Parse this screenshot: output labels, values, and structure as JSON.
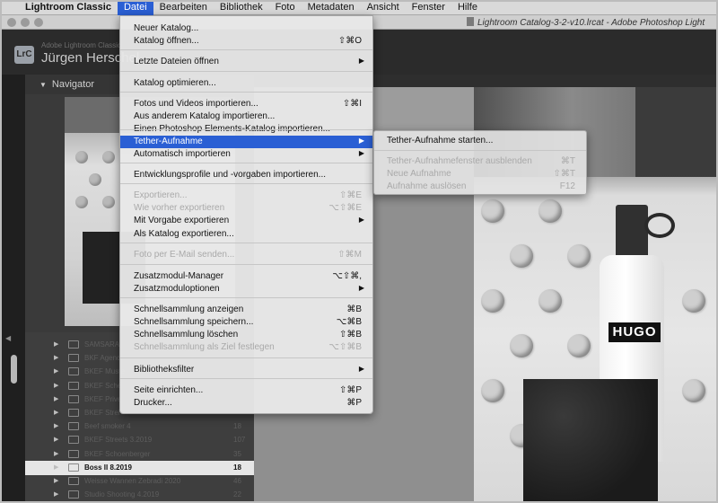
{
  "menubar": {
    "apple_icon": "apple-icon",
    "items": [
      "Lightroom Classic",
      "Datei",
      "Bearbeiten",
      "Bibliothek",
      "Foto",
      "Metadaten",
      "Ansicht",
      "Fenster",
      "Hilfe"
    ]
  },
  "window": {
    "doc_title": "Lightroom Catalog-3-2-v10.lrcat - Adobe Photoshop Light"
  },
  "identity": {
    "licensed_to": "Adobe Lightroom Classic",
    "user_name": "Jürgen Herschel"
  },
  "navigator": {
    "title": "Navigator"
  },
  "collections": [
    {
      "name": "SAMSARA",
      "count": ""
    },
    {
      "name": "BKF Agenc",
      "count": ""
    },
    {
      "name": "BKEF Muste",
      "count": ""
    },
    {
      "name": "BKEF Sche",
      "count": ""
    },
    {
      "name": "BKEF Prive",
      "count": ""
    },
    {
      "name": "BKEF Strei",
      "count": ""
    },
    {
      "name": "Beef smoker 4",
      "count": "18"
    },
    {
      "name": "BKEF Streets 3.2019",
      "count": "107"
    },
    {
      "name": "BKEF Schoenberger",
      "count": "35"
    },
    {
      "name": "Boss II 8.2019",
      "count": "18"
    },
    {
      "name": "Weisse Wannen Zebradi 2020",
      "count": "46"
    },
    {
      "name": "Studio Shooting 4.2019",
      "count": "22"
    }
  ],
  "menu": {
    "items": [
      {
        "label": "Neuer Katalog...",
        "shortcut": "",
        "arrow": false,
        "disabled": false
      },
      {
        "label": "Katalog öffnen...",
        "shortcut": "⇧⌘O",
        "arrow": false,
        "disabled": false
      },
      {
        "label": "Letzte Dateien öffnen",
        "shortcut": "",
        "arrow": true,
        "disabled": false
      },
      {
        "label": "Katalog optimieren...",
        "shortcut": "",
        "arrow": false,
        "disabled": false
      },
      {
        "label": "Fotos und Videos importieren...",
        "shortcut": "⇧⌘I",
        "arrow": false,
        "disabled": false
      },
      {
        "label": "Aus anderem Katalog importieren...",
        "shortcut": "",
        "arrow": false,
        "disabled": false
      },
      {
        "label": "Einen Photoshop Elements-Katalog importieren...",
        "shortcut": "",
        "arrow": false,
        "disabled": false
      },
      {
        "label": "Tether-Aufnahme",
        "shortcut": "",
        "arrow": true,
        "disabled": false,
        "highlighted": true
      },
      {
        "label": "Automatisch importieren",
        "shortcut": "",
        "arrow": true,
        "disabled": false
      },
      {
        "label": "Entwicklungsprofile und -vorgaben importieren...",
        "shortcut": "",
        "arrow": false,
        "disabled": false
      },
      {
        "label": "Exportieren...",
        "shortcut": "⇧⌘E",
        "arrow": false,
        "disabled": true
      },
      {
        "label": "Wie vorher exportieren",
        "shortcut": "⌥⇧⌘E",
        "arrow": false,
        "disabled": true
      },
      {
        "label": "Mit Vorgabe exportieren",
        "shortcut": "",
        "arrow": true,
        "disabled": false
      },
      {
        "label": "Als Katalog exportieren...",
        "shortcut": "",
        "arrow": false,
        "disabled": false
      },
      {
        "label": "Foto per E-Mail senden...",
        "shortcut": "⇧⌘M",
        "arrow": false,
        "disabled": true
      },
      {
        "label": "Zusatzmodul-Manager",
        "shortcut": "⌥⇧⌘,",
        "arrow": false,
        "disabled": false
      },
      {
        "label": "Zusatzmoduloptionen",
        "shortcut": "",
        "arrow": true,
        "disabled": false
      },
      {
        "label": "Schnellsammlung anzeigen",
        "shortcut": "⌘B",
        "arrow": false,
        "disabled": false
      },
      {
        "label": "Schnellsammlung speichern...",
        "shortcut": "⌥⌘B",
        "arrow": false,
        "disabled": false
      },
      {
        "label": "Schnellsammlung löschen",
        "shortcut": "⇧⌘B",
        "arrow": false,
        "disabled": false
      },
      {
        "label": "Schnellsammlung als Ziel festlegen",
        "shortcut": "⌥⇧⌘B",
        "arrow": false,
        "disabled": true
      },
      {
        "label": "Bibliotheksfilter",
        "shortcut": "",
        "arrow": true,
        "disabled": false
      },
      {
        "label": "Seite einrichten...",
        "shortcut": "⇧⌘P",
        "arrow": false,
        "disabled": false
      },
      {
        "label": "Drucker...",
        "shortcut": "⌘P",
        "arrow": false,
        "disabled": false
      }
    ]
  },
  "submenu": {
    "items": [
      {
        "label": "Tether-Aufnahme starten...",
        "shortcut": "",
        "disabled": false
      },
      {
        "label": "Tether-Aufnahmefenster ausblenden",
        "shortcut": "⌘T",
        "disabled": true
      },
      {
        "label": "Neue Aufnahme",
        "shortcut": "⇧⌘T",
        "disabled": true
      },
      {
        "label": "Aufnahme auslösen",
        "shortcut": "F12",
        "disabled": true
      }
    ]
  },
  "photo": {
    "bottle_label": "HUGO"
  },
  "colors": {
    "menu_highlight": "#2a5fd4",
    "panel_dark": "#2b2b2b"
  }
}
